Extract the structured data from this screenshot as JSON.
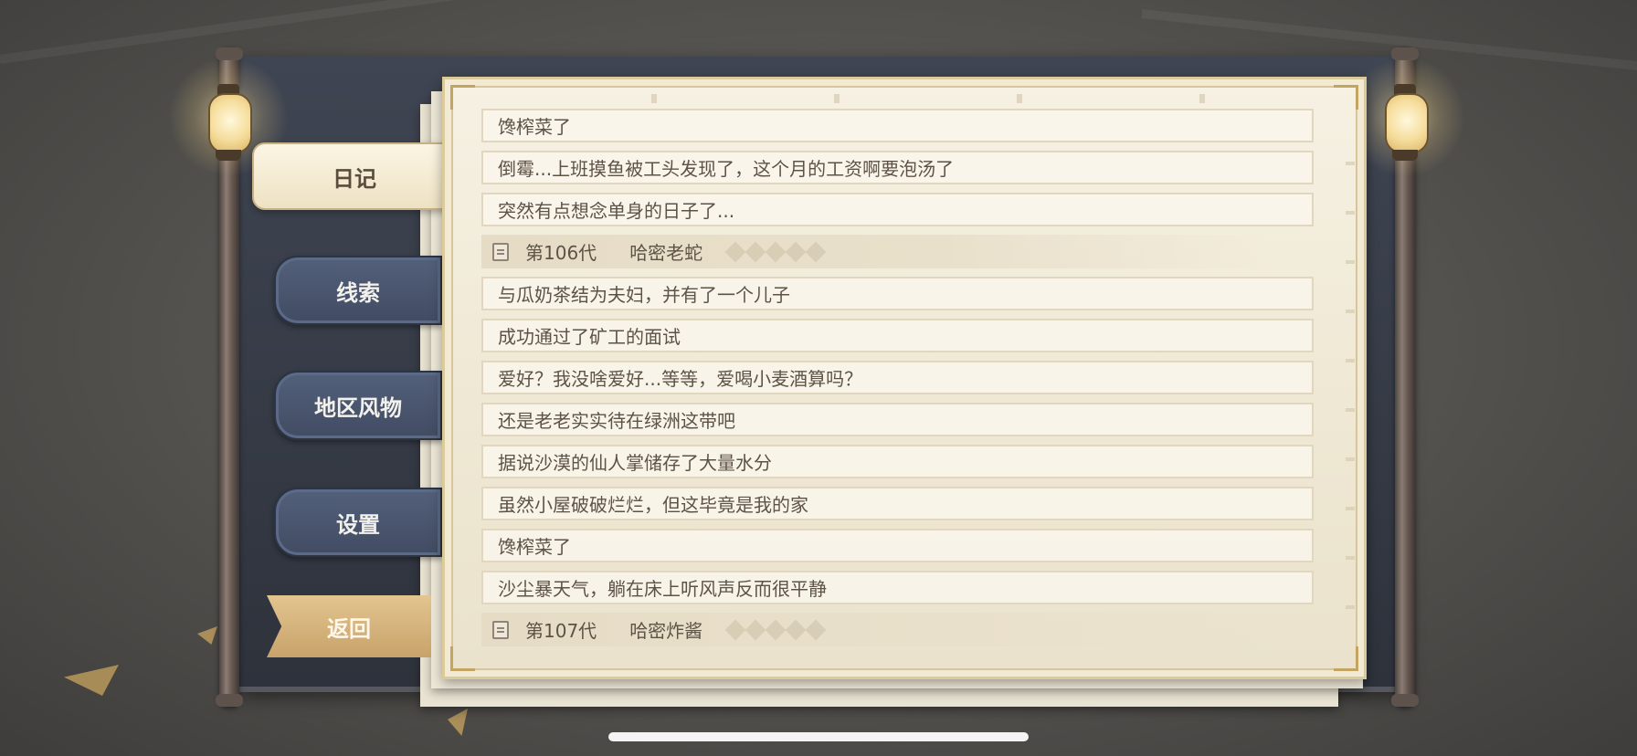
{
  "tabs": {
    "diary": "日记",
    "clues": "线索",
    "regional_features": "地区风物",
    "settings": "设置",
    "back": "返回"
  },
  "entries": [
    {
      "type": "entry",
      "text": "馋榨菜了"
    },
    {
      "type": "entry",
      "text": "倒霉...上班摸鱼被工头发现了，这个月的工资啊要泡汤了"
    },
    {
      "type": "entry",
      "text": "突然有点想念单身的日子了..."
    },
    {
      "type": "generation",
      "gen": "第106代",
      "name": "哈密老蛇"
    },
    {
      "type": "entry",
      "text": "与瓜奶茶结为夫妇，并有了一个儿子"
    },
    {
      "type": "entry",
      "text": "成功通过了矿工的面试"
    },
    {
      "type": "entry",
      "text": "爱好？我没啥爱好...等等，爱喝小麦酒算吗？"
    },
    {
      "type": "entry",
      "text": "还是老老实实待在绿洲这带吧"
    },
    {
      "type": "entry",
      "text": "据说沙漠的仙人掌储存了大量水分"
    },
    {
      "type": "entry",
      "text": "虽然小屋破破烂烂，但这毕竟是我的家"
    },
    {
      "type": "entry",
      "text": "馋榨菜了"
    },
    {
      "type": "entry",
      "text": "沙尘暴天气，躺在床上听风声反而很平静"
    },
    {
      "type": "generation",
      "gen": "第107代",
      "name": "哈密炸酱"
    }
  ],
  "icons": {
    "lantern": "lantern-icon",
    "generation": "document-icon"
  },
  "colors": {
    "tab_blue": "#4a5670",
    "tab_active": "#f6eed8",
    "back_gold": "#d6b57e",
    "paper": "#f2ecdc",
    "text": "#5d5246"
  }
}
